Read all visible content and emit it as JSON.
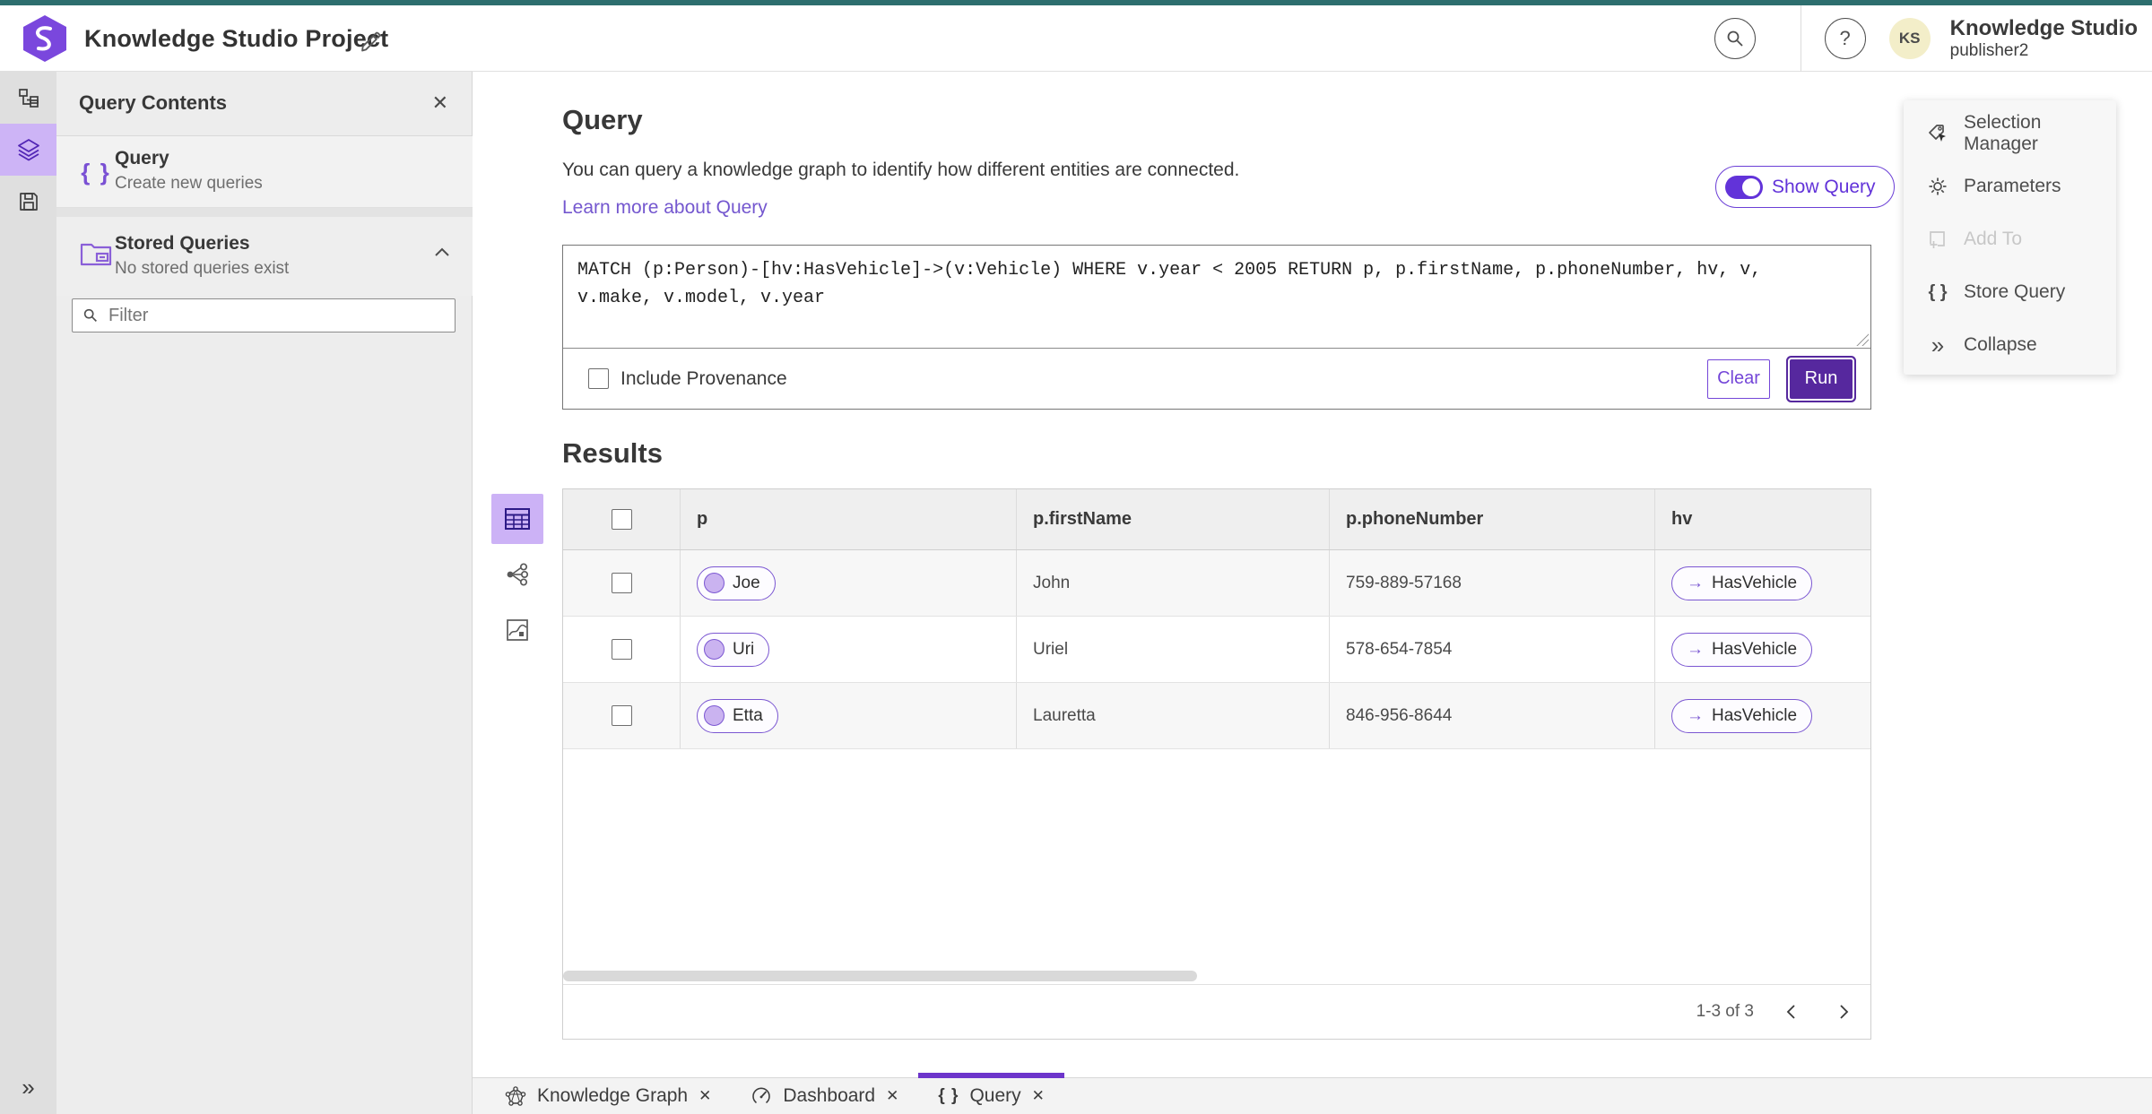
{
  "header": {
    "app_title": "Knowledge Studio Project",
    "user_initials": "KS",
    "user_name": "Knowledge Studio",
    "user_role": "publisher2"
  },
  "sidebar": {
    "panel_title": "Query Contents",
    "items": [
      {
        "label": "Query",
        "description": "Create new queries"
      },
      {
        "label": "Stored Queries",
        "description": "No stored queries exist"
      }
    ],
    "filter_placeholder": "Filter"
  },
  "query_section": {
    "title": "Query",
    "description": "You can query a knowledge graph to identify how different entities are connected.",
    "learn_more": "Learn more about Query",
    "show_query_label": "Show Query",
    "query_text": "MATCH (p:Person)-[hv:HasVehicle]->(v:Vehicle) WHERE v.year < 2005 RETURN p, p.firstName, p.phoneNumber, hv, v, v.make, v.model, v.year",
    "include_provenance_label": "Include Provenance",
    "clear_label": "Clear",
    "run_label": "Run"
  },
  "results": {
    "title": "Results",
    "table": {
      "columns": [
        "p",
        "p.firstName",
        "p.phoneNumber",
        "hv"
      ],
      "rows": [
        {
          "p": "Joe",
          "firstName": "John",
          "phoneNumber": "759-889-57168",
          "hv": "HasVehicle"
        },
        {
          "p": "Uri",
          "firstName": "Uriel",
          "phoneNumber": "578-654-7854",
          "hv": "HasVehicle"
        },
        {
          "p": "Etta",
          "firstName": "Lauretta",
          "phoneNumber": "846-956-8644",
          "hv": "HasVehicle"
        }
      ]
    },
    "pagination": {
      "range_label": "1-3 of 3"
    }
  },
  "tools_panel": {
    "items": [
      {
        "label": "Selection Manager"
      },
      {
        "label": "Parameters"
      },
      {
        "label": "Add To"
      },
      {
        "label": "Store Query"
      },
      {
        "label": "Collapse"
      }
    ]
  },
  "tabs": [
    {
      "label": "Knowledge Graph"
    },
    {
      "label": "Dashboard"
    },
    {
      "label": "Query"
    }
  ],
  "glyphs": {
    "help": "?",
    "close": "✕",
    "braces": "{ }",
    "chevron_double": "»",
    "arrow_right": "→"
  },
  "colors": {
    "accent_purple": "#6b3fd6",
    "deep_purple_run": "#56289e",
    "teal_top_strip": "#2d6e6e",
    "rail_active_bg": "#cdb4f6",
    "pill_circle_fill": "#cab3f0",
    "avatar_bg": "#f3eec9"
  }
}
